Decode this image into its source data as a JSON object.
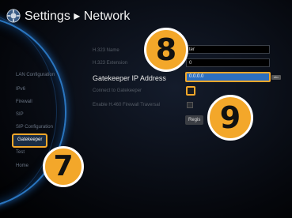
{
  "header": {
    "title": "Settings ▸ Network",
    "gear_icon": "gear-icon"
  },
  "sidebar": {
    "items": [
      {
        "label": "LAN Configuration"
      },
      {
        "label": "IPv6"
      },
      {
        "label": "Firewall"
      },
      {
        "label": "SIP"
      },
      {
        "label": "SIP Configuration"
      },
      {
        "label": "Gatekeeper",
        "selected": true
      },
      {
        "label": "Test"
      },
      {
        "label": "Home"
      }
    ]
  },
  "form": {
    "h323_name_label": "H.323 Name",
    "h323_name_value": "ter",
    "h323_extension_label": "H.323 Extension",
    "h323_extension_value": "0",
    "gatekeeper_ip_label": "Gatekeeper IP Address",
    "gatekeeper_ip_value": "0.0.0.0",
    "gatekeeper_ip_tag": "abc",
    "connect_gatekeeper_label": "Connect to Gatekeeper",
    "h460_label": "Enable H.460 Firewall Traversal",
    "register_label": "Regis"
  },
  "callouts": {
    "seven": "7",
    "eight": "8",
    "nine": "9"
  },
  "colors": {
    "accent": "#f3a72a",
    "highlight_field": "#2c6fc0",
    "arc": "#2a76c0"
  }
}
